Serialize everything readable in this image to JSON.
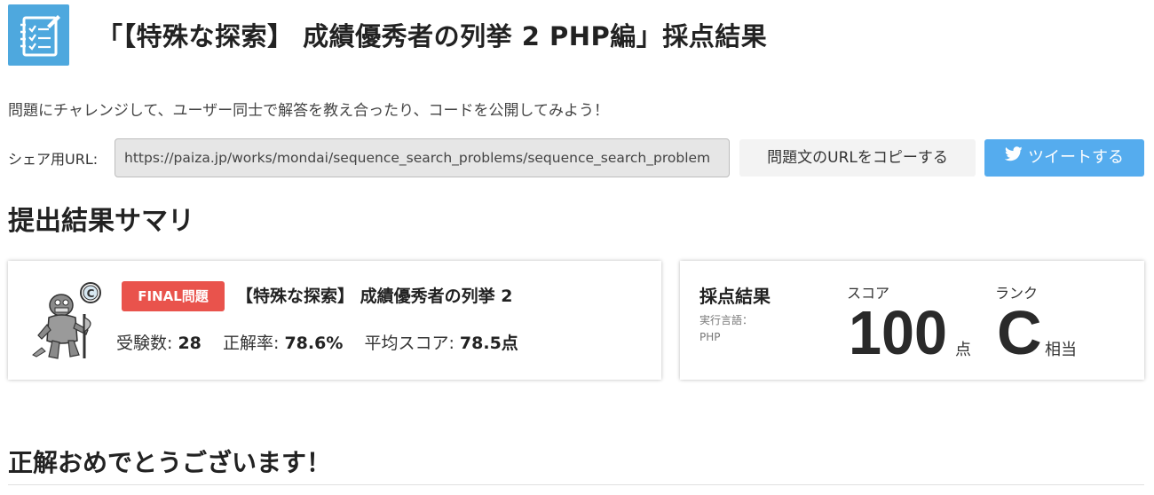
{
  "header": {
    "title": "「【特殊な探索】 成績優秀者の列挙 2 PHP編」採点結果",
    "icon": "checklist-notebook-icon"
  },
  "intro": "問題にチャレンジして、ユーザー同士で解答を教え合ったり、コードを公開してみよう！",
  "share": {
    "label": "シェア用URL:",
    "url": "https://paiza.jp/works/mondai/sequence_search_problems/sequence_search_problem",
    "copy_label": "問題文のURLをコピーする",
    "tweet_label": "ツイートする"
  },
  "summary_title": "提出結果サマリ",
  "problem": {
    "avatar": "lizard-knight-avatar-icon",
    "rank_badge": "C",
    "badge": "FINAL問題",
    "name": "【特殊な探索】 成績優秀者の列挙 2",
    "examinees_label": "受験数:",
    "examinees": "28",
    "accuracy_label": "正解率:",
    "accuracy": "78.6%",
    "avg_label": "平均スコア:",
    "avg_score": "78.5点"
  },
  "result": {
    "title": "採点結果",
    "lang_label": "実行言語：",
    "lang": "PHP",
    "score_label": "スコア",
    "score": "100",
    "score_unit": "点",
    "rank_label": "ランク",
    "rank": "C",
    "rank_unit": "相当"
  },
  "congrats": "正解おめでとうございます！",
  "colors": {
    "icon_bg": "#4ea8de",
    "badge": "#e9534c",
    "tweet": "#55acee"
  }
}
